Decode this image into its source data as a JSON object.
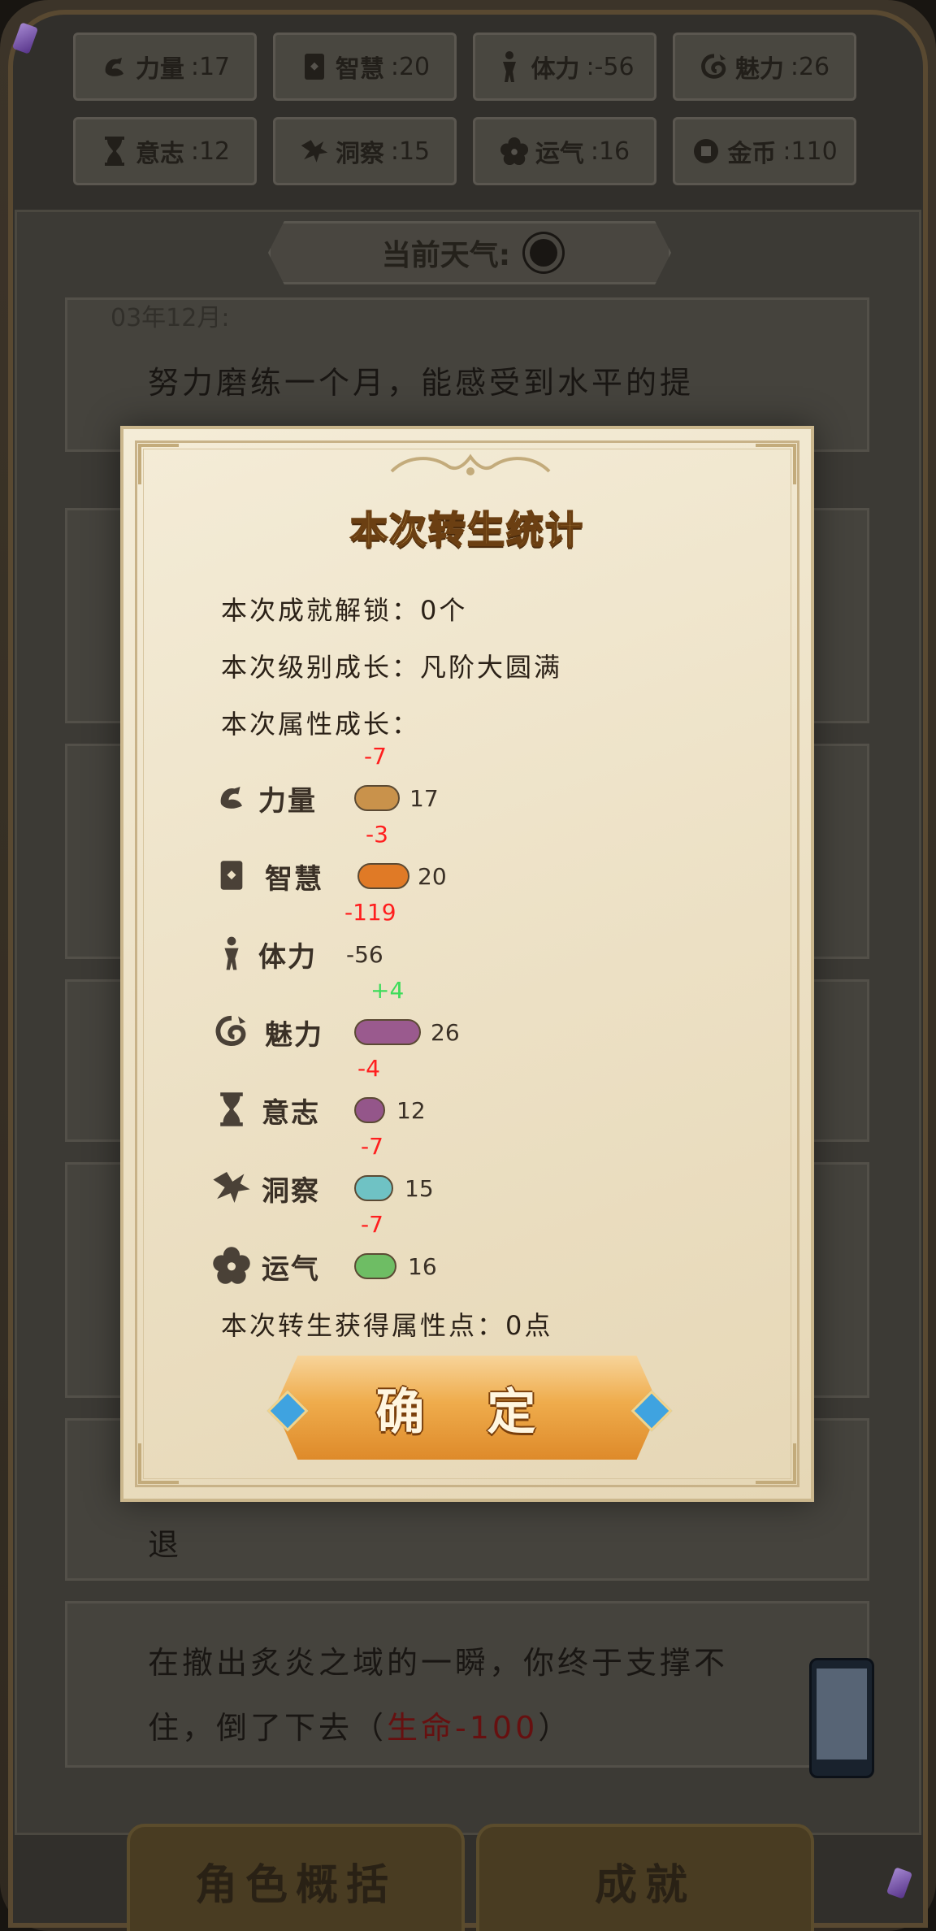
{
  "stats": [
    {
      "icon": "muscle-icon",
      "label": "力量",
      "value": ":17"
    },
    {
      "icon": "book-icon",
      "label": "智慧",
      "value": ":20"
    },
    {
      "icon": "person-icon",
      "label": "体力",
      "value": ":-56"
    },
    {
      "icon": "charm-icon",
      "label": "魅力",
      "value": ":26"
    },
    {
      "icon": "hourglass-icon",
      "label": "意志",
      "value": ":12"
    },
    {
      "icon": "eagle-icon",
      "label": "洞察",
      "value": ":15"
    },
    {
      "icon": "clover-icon",
      "label": "运气",
      "value": ":16"
    },
    {
      "icon": "coin-icon",
      "label": "金币",
      "value": ":110"
    }
  ],
  "weather": {
    "label": "当前天气:",
    "icon": "sun-icon"
  },
  "log": {
    "entry1_date": "03年12月:",
    "entry1_text": "努力磨练一个月，能感受到水平的提",
    "entry_partial": "退",
    "last_line1": "在撤出炙炎之域的一瞬，你终于支撑不",
    "last_line2_a": "住，倒了下去（",
    "last_line2_red": "生命-100",
    "last_line2_b": "）"
  },
  "tabs": {
    "overview": "角色概括",
    "achievements": "成就"
  },
  "modal": {
    "title": "本次转生统计",
    "achievements_line": "本次成就解锁：0个",
    "level_line": "本次级别成长：凡阶大圆满",
    "attr_header": "本次属性成长：",
    "points_line": "本次转生获得属性点：0点",
    "confirm": "确 定",
    "attributes": [
      {
        "name": "力量",
        "icon": "muscle-icon",
        "delta": "-7",
        "value": "17",
        "color": "#c9924b"
      },
      {
        "name": "智慧",
        "icon": "book-icon",
        "delta": "-3",
        "value": "20",
        "color": "#e07a26"
      },
      {
        "name": "体力",
        "icon": "person-icon",
        "delta": "-119",
        "value": "-56",
        "color": ""
      },
      {
        "name": "魅力",
        "icon": "charm-icon",
        "delta": "+4",
        "value": "26",
        "color": "#9a5a8e"
      },
      {
        "name": "意志",
        "icon": "hourglass-icon",
        "delta": "-4",
        "value": "12",
        "color": "#94568a"
      },
      {
        "name": "洞察",
        "icon": "eagle-icon",
        "delta": "-7",
        "value": "15",
        "color": "#6fc2c4"
      },
      {
        "name": "运气",
        "icon": "clover-icon",
        "delta": "-7",
        "value": "16",
        "color": "#6ebd64"
      }
    ]
  }
}
